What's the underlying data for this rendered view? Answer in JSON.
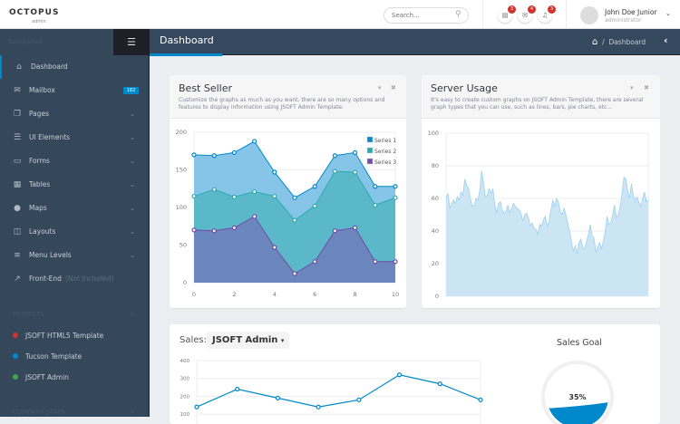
{
  "header": {
    "logo": "OCTOPUS",
    "logo_sub": "admin",
    "search_placeholder": "Search...",
    "notifications": [
      {
        "icon": "tasks-icon",
        "count": "3"
      },
      {
        "icon": "envelope-icon",
        "count": "4"
      },
      {
        "icon": "bell-icon",
        "count": "3"
      }
    ],
    "user": {
      "name": "John Doe Junior",
      "role": "administrator"
    }
  },
  "sidebar": {
    "nav_label": "Navigation",
    "items": [
      {
        "label": "Dashboard",
        "icon": "home-icon",
        "active": true
      },
      {
        "label": "Mailbox",
        "icon": "envelope-icon",
        "badge": "182"
      },
      {
        "label": "Pages",
        "icon": "copy-icon",
        "chevron": true
      },
      {
        "label": "UI Elements",
        "icon": "tasks-icon",
        "chevron": true
      },
      {
        "label": "Forms",
        "icon": "list-alt-icon",
        "chevron": true
      },
      {
        "label": "Tables",
        "icon": "table-icon",
        "chevron": true
      },
      {
        "label": "Maps",
        "icon": "map-marker-icon",
        "chevron": true
      },
      {
        "label": "Layouts",
        "icon": "columns-icon",
        "chevron": true
      },
      {
        "label": "Menu Levels",
        "icon": "align-left-icon",
        "chevron": true
      },
      {
        "label": "Front-End",
        "icon": "external-link-icon",
        "note": "(Not Included)"
      }
    ],
    "projects_label": "PROJECTS",
    "projects": [
      {
        "label": "JSOFT HTML5 Template",
        "color": "#d2322d"
      },
      {
        "label": "Tucson Template",
        "color": "#0088cc"
      },
      {
        "label": "JSOFT Admin",
        "color": "#47a447"
      }
    ],
    "company_label": "COMPANY STATS"
  },
  "page": {
    "title": "Dashboard",
    "breadcrumb": "Dashboard"
  },
  "best_seller": {
    "title": "Best Seller",
    "subtitle": "Customize the graphs as much as you want, there are so many options and features to display information using JSOFT Admin Template."
  },
  "server_usage": {
    "title": "Server Usage",
    "subtitle": "It's easy to create custom graphs on JSOFT Admin Template, there are several graph types that you can use, such as lines, bars, pie charts, etc..."
  },
  "sales": {
    "label": "Sales:",
    "selected": "JSOFT Admin",
    "goal_title": "Sales Goal",
    "goal_value": "35%",
    "goal_fraction": 0.35
  },
  "chart_data": [
    {
      "type": "area",
      "stacked": true,
      "x": [
        0,
        1,
        2,
        3,
        4,
        5,
        6,
        7,
        8,
        9,
        10
      ],
      "xticks": [
        "0",
        "2",
        "4",
        "6",
        "8",
        "10"
      ],
      "yticks": [
        "0",
        "50",
        "100",
        "150",
        "200"
      ],
      "ylim": [
        0,
        200
      ],
      "legend": "top-right",
      "series": [
        {
          "name": "Series 1",
          "color": "#0088cc",
          "values": [
            55,
            45,
            59,
            67,
            32,
            30,
            26,
            21,
            26,
            25,
            15
          ]
        },
        {
          "name": "Series 2",
          "color": "#2baab1",
          "values": [
            45,
            55,
            41,
            33,
            68,
            71,
            74,
            79,
            74,
            75,
            85
          ]
        },
        {
          "name": "Series 3",
          "color": "#734ba9",
          "values": [
            70,
            69,
            73,
            88,
            47,
            12,
            28,
            69,
            73,
            28,
            28
          ]
        }
      ]
    },
    {
      "type": "area",
      "ylim": [
        0,
        100
      ],
      "yticks": [
        "0",
        "20",
        "40",
        "60",
        "80",
        "100"
      ],
      "color": "#9fd0ed",
      "values": [
        60,
        63,
        54,
        57,
        59,
        57,
        61,
        59,
        64,
        62,
        72,
        68,
        66,
        60,
        55,
        56,
        60,
        59,
        65,
        77,
        70,
        61,
        62,
        66,
        63,
        66,
        57,
        51,
        57,
        58,
        53,
        51,
        52,
        56,
        51,
        54,
        57,
        55,
        54,
        53,
        51,
        46,
        50,
        51,
        48,
        43,
        45,
        42,
        41,
        38,
        44,
        43,
        47,
        49,
        43,
        46,
        53,
        59,
        55,
        60,
        58,
        52,
        50,
        54,
        50,
        45,
        40,
        33,
        28,
        31,
        26,
        33,
        35,
        30,
        29,
        33,
        38,
        44,
        37,
        36,
        27,
        30,
        33,
        29,
        34,
        40,
        49,
        44,
        45,
        50,
        56,
        48,
        50,
        55,
        63,
        73,
        72,
        65,
        60,
        69,
        62,
        59,
        61,
        58,
        55,
        60,
        64,
        58,
        59
      ]
    },
    {
      "type": "line",
      "ylim": [
        0,
        400
      ],
      "yticks": [
        "100",
        "200",
        "300",
        "400"
      ],
      "color": "#0088cc",
      "values": [
        140,
        240,
        190,
        140,
        180,
        320,
        270,
        180
      ]
    }
  ]
}
